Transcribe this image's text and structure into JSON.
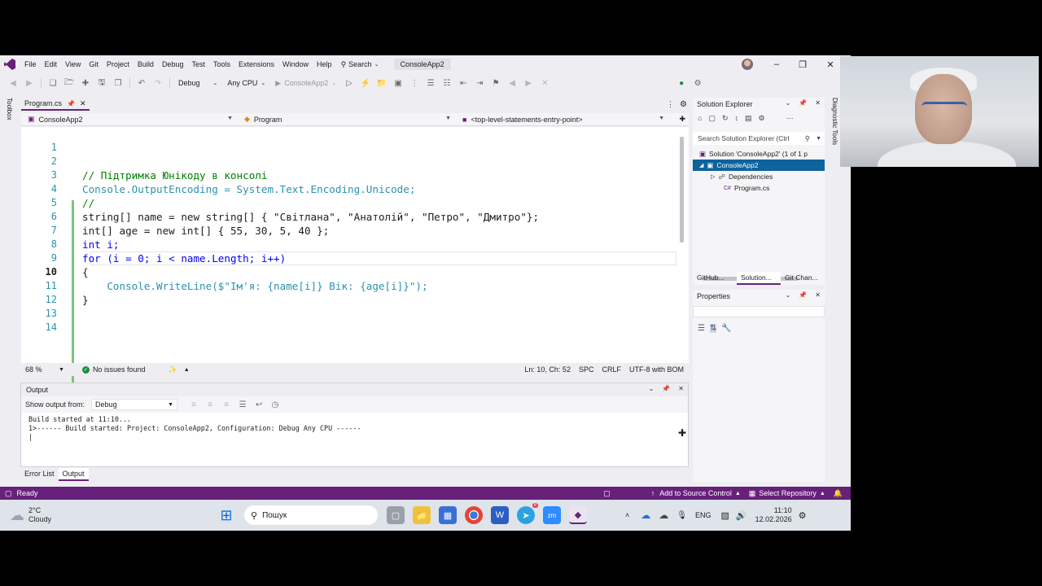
{
  "titlebar": {
    "menus": [
      "File",
      "Edit",
      "View",
      "Git",
      "Project",
      "Build",
      "Debug",
      "Test",
      "Tools",
      "Extensions",
      "Window",
      "Help"
    ],
    "search_label": "Search",
    "solution_name": "ConsoleApp2"
  },
  "toolbar": {
    "configuration": "Debug",
    "platform": "Any CPU",
    "start_target": "ConsoleApp2"
  },
  "side_strips": {
    "left": "Toolbox",
    "right": "Diagnostic Tools"
  },
  "document": {
    "tab_label": "Program.cs",
    "nav_project": "ConsoleApp2",
    "nav_class": "Program",
    "nav_member": "<top-level-statements-entry-point>"
  },
  "code": {
    "line_numbers": [
      "1",
      "2",
      "3",
      "4",
      "5",
      "6",
      "7",
      "8",
      "9",
      "10",
      "11",
      "12",
      "13",
      "14"
    ],
    "current_line": 10,
    "lines": [
      "",
      "// Підтримка Юнікоду в консолі",
      "Console.OutputEncoding = System.Text.Encoding.Unicode;",
      "//",
      "string[] name = new string[] { \"Світлана\", \"Анатолій\", \"Петро\", \"Дмитро\"};",
      "int[] age = new int[] { 55, 30, 5, 40 };",
      "int i;",
      "for (i = 0; i < name.Length; i++)",
      "{",
      "    Console.WriteLine($\"Ім'я: {name[i]} Вік: {age[i]}\");",
      "}",
      "",
      "",
      ""
    ]
  },
  "editor_status": {
    "zoom": "68 %",
    "issues": "No issues found",
    "position": "Ln: 10, Ch: 52",
    "whitespace": "SPC",
    "line_ending": "CRLF",
    "encoding": "UTF-8 with BOM"
  },
  "output": {
    "title": "Output",
    "show_from_label": "Show output from:",
    "source": "Debug",
    "lines": [
      "Build started at 11:10...",
      "1>------ Build started: Project: ConsoleApp2, Configuration: Debug Any CPU ------"
    ]
  },
  "bottom_tabs": [
    "Error List",
    "Output"
  ],
  "solution_explorer": {
    "title": "Solution Explorer",
    "search_placeholder": "Search Solution Explorer (Ctrl",
    "solution_node": "Solution 'ConsoleApp2' (1 of 1 p",
    "project_node": "ConsoleApp2",
    "dependencies_node": "Dependencies",
    "file_node": "Program.cs",
    "file_prefix": "C#"
  },
  "right_tabs": [
    "GitHub...",
    "Solution...",
    "Git Chan..."
  ],
  "properties": {
    "title": "Properties"
  },
  "statusbar": {
    "state": "Ready",
    "add_source_control": "Add to Source Control",
    "select_repository": "Select Repository"
  },
  "taskbar": {
    "temperature": "2°C",
    "weather": "Cloudy",
    "search_placeholder": "Пошук",
    "language": "ENG",
    "time": "11:10",
    "date": "12.02.2026",
    "telegram_badge": "8"
  },
  "colors": {
    "accent": "#68217a",
    "keyword": "#0000ff",
    "string": "#a31515",
    "comment": "#008000",
    "type": "#2b91af"
  }
}
